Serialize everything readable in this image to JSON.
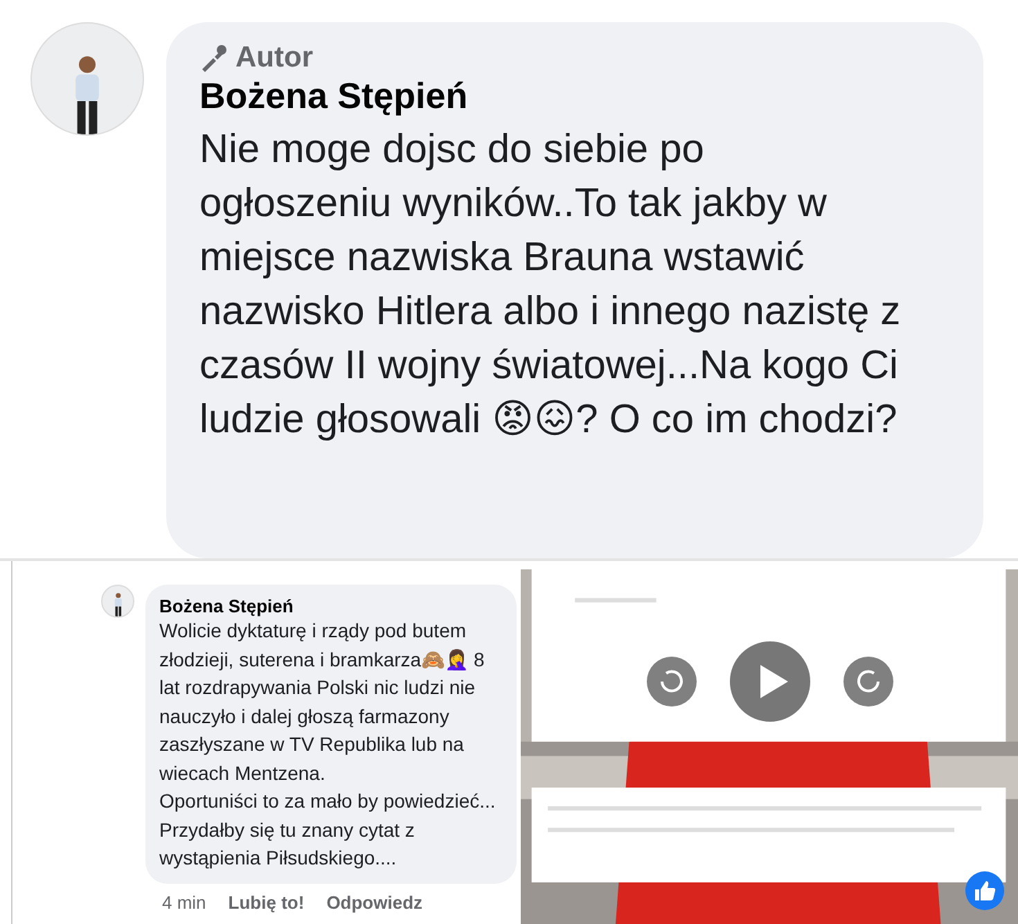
{
  "main_comment": {
    "badge": "Autor",
    "author": "Bożena Stępień",
    "text": "Nie moge dojsc do siebie po ogłoszeniu wyników..To tak jakby w miejsce nazwiska Brauna wstawić nazwisko Hitlera albo i innego nazistę z czasów II wojny światowej...Na kogo Ci ludzie głosowali 😡😖?  O co im chodzi?"
  },
  "reply_comment": {
    "author": "Bożena Stępień",
    "text": "Wolicie dyktaturę i rządy pod butem złodzieji, suterena i bramkarza🙈🤦‍♀️ 8 lat rozdrapywania Polski nic ludzi nie nauczyło  i dalej głoszą farmazony zaszłyszane w TV Republika lub na wiecach Mentzena.\nOportuniści to za mało by powiedzieć...\nPrzydałby się tu znany cytat z wystąpienia Piłsudskiego....",
    "time": "4 min",
    "actions": [
      "Lubię to!",
      "Odpowiedz"
    ]
  }
}
